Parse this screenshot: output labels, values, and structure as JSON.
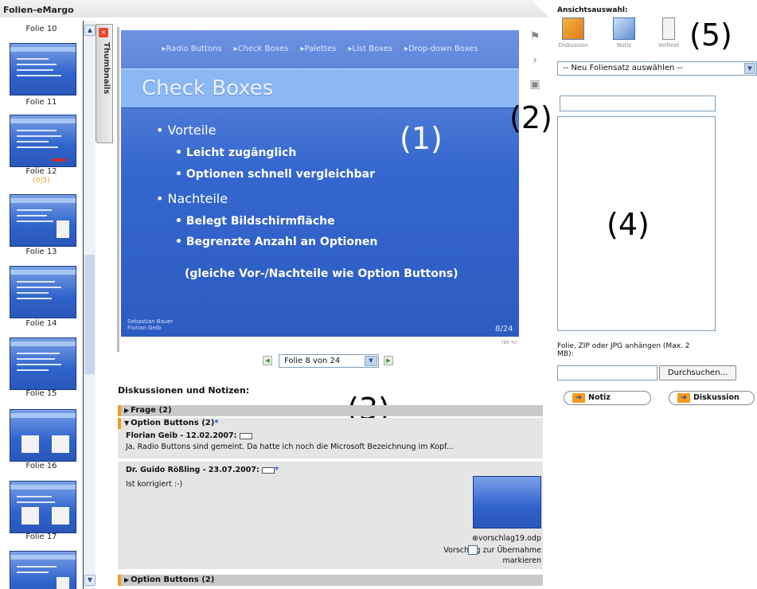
{
  "app": {
    "title": "Folien-eMargo"
  },
  "thumbnails": {
    "tab_label": "Thumbnails",
    "items": [
      {
        "label": "Folie 10"
      },
      {
        "label": "Folie 11"
      },
      {
        "label": "Folie 12",
        "comments": "(0|5)"
      },
      {
        "label": "Folie 13"
      },
      {
        "label": "Folie 14"
      },
      {
        "label": "Folie 15"
      },
      {
        "label": "Folie 16"
      },
      {
        "label": "Folie 17"
      }
    ]
  },
  "slide": {
    "nav": [
      "Radio Buttons",
      "Check Boxes",
      "Palettes",
      "List Boxes",
      "Drop-down Boxes"
    ],
    "title": "Check Boxes",
    "bullets": {
      "b1": "Vorteile",
      "b2": "Leicht zugänglich",
      "b3": "Optionen schnell vergleichbar",
      "b4": "Nachteile",
      "b5": "Belegt Bildschirmfläche",
      "b6": "Begrenzte Anzahl an Optionen",
      "b7": "(gleiche Vor-/Nachteile wie Option Buttons)"
    },
    "footer": {
      "line1": "Sebastian Bauer",
      "line2": "Florian Geib"
    },
    "page": "8/24",
    "zoom": "(90 %)"
  },
  "markers": {
    "m1": "(1)",
    "m2": "(2)",
    "m3": "(3)",
    "m4": "(4)",
    "m5": "(5)"
  },
  "pager": {
    "select_value": "Folie 8 von 24"
  },
  "discussions": {
    "heading": "Diskussionen und Notizen:",
    "groups": [
      {
        "title": "Frage (2)"
      },
      {
        "title": "Option Buttons (2)"
      },
      {
        "title": "Option Buttons (2)"
      }
    ],
    "posts": [
      {
        "author": "Florian Geib - 12.02.2007:",
        "text": "Ja, Radio Buttons sind gemeint. Da hatte ich noch die Microsoft Bezeichnung im Kopf..."
      },
      {
        "author": "Dr. Guido Rößling - 23.07.2007:",
        "text": "Ist korrigiert :-)"
      }
    ],
    "attachment": {
      "filename": "vorschlag19.odp",
      "suggest": "Vorschlag zur Übernahme markieren"
    }
  },
  "right_panel": {
    "view_label": "Ansichtsauswahl:",
    "views": [
      {
        "label": "Diskussion"
      },
      {
        "label": "Notiz"
      },
      {
        "label": "Volltext"
      }
    ],
    "set_select": "-- Neu Foliensatz auswählen --",
    "attach_label": "Folie, ZIP oder JPG anhängen (Max. 2 MB):",
    "browse": "Durchsuchen...",
    "note_button": "Notiz",
    "discussion_button": "Diskussion"
  },
  "colors": {
    "slide_blue": "#3567cf",
    "accent_orange": "#f39a1e",
    "thread_bg": "#e5e5e5"
  }
}
